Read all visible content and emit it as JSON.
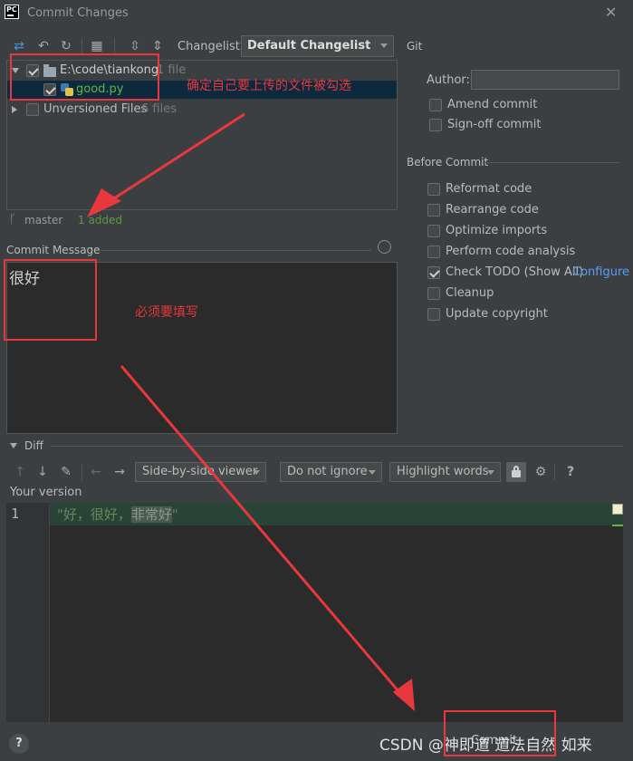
{
  "window": {
    "title": "Commit Changes",
    "logo_text": "PC",
    "close_glyph": "✕"
  },
  "toolbar": {
    "changelist_label": "Changelist:",
    "changelist_value": "Default Changelist",
    "git_label": "Git"
  },
  "tree": {
    "root": {
      "path": "E:\\code\\tiankong",
      "count": "1 file",
      "checked": true
    },
    "file": {
      "name": "good.py",
      "checked": true
    },
    "unversioned": {
      "label": "Unversioned Files",
      "count": "6 files",
      "checked": false
    }
  },
  "status": {
    "branch": "master",
    "added": "1 added"
  },
  "commit_message": {
    "label": "Commit Message",
    "value": "很好"
  },
  "git_options": {
    "author_label": "Author:",
    "author_value": "",
    "amend_commit": "Amend commit",
    "signoff_commit": "Sign-off commit"
  },
  "before_commit": {
    "label": "Before Commit",
    "options": [
      {
        "label": "Reformat code",
        "checked": false
      },
      {
        "label": "Rearrange code",
        "checked": false
      },
      {
        "label": "Optimize imports",
        "checked": false
      },
      {
        "label": "Perform code analysis",
        "checked": false
      },
      {
        "label": "Check TODO (Show All)",
        "checked": true,
        "link": "Configure"
      },
      {
        "label": "Cleanup",
        "checked": false
      },
      {
        "label": "Update copyright",
        "checked": false
      }
    ]
  },
  "diff": {
    "label": "Diff",
    "viewer": "Side-by-side viewer",
    "ignore": "Do not ignore",
    "highlight": "Highlight words",
    "your_version": "Your version",
    "line_number": "1",
    "code_prefix": "\"好，很好，",
    "code_highlight": "非常好",
    "code_suffix": "\""
  },
  "annotations": {
    "note_files": "确定自己要上传的文件被勾选",
    "note_message": "必须要填写"
  },
  "footer": {
    "help": "?",
    "commit_label": "Commit",
    "watermark": "CSDN @神即道 道法自然 如来"
  },
  "colors": {
    "background": "#3c3f41",
    "editor": "#2b2b2b",
    "annotation_red": "#e8383d",
    "link_blue": "#589df6",
    "added_green": "#62b543"
  }
}
